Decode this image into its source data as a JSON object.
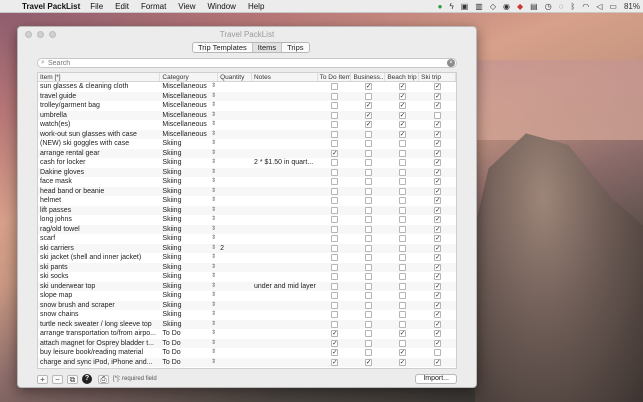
{
  "menubar": {
    "app": "Travel PackList",
    "menus": [
      "File",
      "Edit",
      "Format",
      "View",
      "Window",
      "Help"
    ],
    "battery": "81%"
  },
  "window": {
    "title": "Travel PackList",
    "tabs": [
      "Trip Templates",
      "Items",
      "Trips"
    ],
    "active_tab": "Items"
  },
  "search": {
    "placeholder": "Search"
  },
  "table": {
    "headers": [
      "Item [*]",
      "Category",
      "Quantity",
      "Notes",
      "To Do Item",
      "Business...",
      "Beach trip",
      "Ski trip"
    ],
    "rows": [
      {
        "item": "sun glasses & cleaning cloth",
        "category": "Miscellaneous",
        "qty": "",
        "notes": "",
        "todo": false,
        "business": true,
        "beach": true,
        "ski": true
      },
      {
        "item": "travel guide",
        "category": "Miscellaneous",
        "qty": "",
        "notes": "",
        "todo": false,
        "business": false,
        "beach": true,
        "ski": true
      },
      {
        "item": "trolley/garment bag",
        "category": "Miscellaneous",
        "qty": "",
        "notes": "",
        "todo": false,
        "business": true,
        "beach": true,
        "ski": true
      },
      {
        "item": "umbrella",
        "category": "Miscellaneous",
        "qty": "",
        "notes": "",
        "todo": false,
        "business": true,
        "beach": true,
        "ski": false
      },
      {
        "item": "watch(es)",
        "category": "Miscellaneous",
        "qty": "",
        "notes": "",
        "todo": false,
        "business": true,
        "beach": true,
        "ski": true
      },
      {
        "item": "work-out sun glasses with case",
        "category": "Miscellaneous",
        "qty": "",
        "notes": "",
        "todo": false,
        "business": false,
        "beach": true,
        "ski": true
      },
      {
        "item": "(NEW) ski goggles with case",
        "category": "Skiing",
        "qty": "",
        "notes": "",
        "todo": false,
        "business": false,
        "beach": false,
        "ski": true
      },
      {
        "item": "arrange rental gear",
        "category": "Skiing",
        "qty": "",
        "notes": "",
        "todo": true,
        "business": false,
        "beach": false,
        "ski": true
      },
      {
        "item": "cash for locker",
        "category": "Skiing",
        "qty": "",
        "notes": "2 * $1.50 in quart...",
        "todo": false,
        "business": false,
        "beach": false,
        "ski": true
      },
      {
        "item": "Dakine gloves",
        "category": "Skiing",
        "qty": "",
        "notes": "",
        "todo": false,
        "business": false,
        "beach": false,
        "ski": true
      },
      {
        "item": "face mask",
        "category": "Skiing",
        "qty": "",
        "notes": "",
        "todo": false,
        "business": false,
        "beach": false,
        "ski": true
      },
      {
        "item": "head band or beanie",
        "category": "Skiing",
        "qty": "",
        "notes": "",
        "todo": false,
        "business": false,
        "beach": false,
        "ski": true
      },
      {
        "item": "helmet",
        "category": "Skiing",
        "qty": "",
        "notes": "",
        "todo": false,
        "business": false,
        "beach": false,
        "ski": true
      },
      {
        "item": "lift passes",
        "category": "Skiing",
        "qty": "",
        "notes": "",
        "todo": false,
        "business": false,
        "beach": false,
        "ski": true
      },
      {
        "item": "long johns",
        "category": "Skiing",
        "qty": "",
        "notes": "",
        "todo": false,
        "business": false,
        "beach": false,
        "ski": true
      },
      {
        "item": "rag/old towel",
        "category": "Skiing",
        "qty": "",
        "notes": "",
        "todo": false,
        "business": false,
        "beach": false,
        "ski": true
      },
      {
        "item": "scarf",
        "category": "Skiing",
        "qty": "",
        "notes": "",
        "todo": false,
        "business": false,
        "beach": false,
        "ski": true
      },
      {
        "item": "ski carriers",
        "category": "Skiing",
        "qty": "2",
        "notes": "",
        "todo": false,
        "business": false,
        "beach": false,
        "ski": true
      },
      {
        "item": "ski jacket (shell and inner jacket)",
        "category": "Skiing",
        "qty": "",
        "notes": "",
        "todo": false,
        "business": false,
        "beach": false,
        "ski": true
      },
      {
        "item": "ski pants",
        "category": "Skiing",
        "qty": "",
        "notes": "",
        "todo": false,
        "business": false,
        "beach": false,
        "ski": true
      },
      {
        "item": "ski socks",
        "category": "Skiing",
        "qty": "",
        "notes": "",
        "todo": false,
        "business": false,
        "beach": false,
        "ski": true
      },
      {
        "item": "ski underwear top",
        "category": "Skiing",
        "qty": "",
        "notes": "under and mid layer",
        "todo": false,
        "business": false,
        "beach": false,
        "ski": true
      },
      {
        "item": "slope map",
        "category": "Skiing",
        "qty": "",
        "notes": "",
        "todo": false,
        "business": false,
        "beach": false,
        "ski": true
      },
      {
        "item": "snow brush and scraper",
        "category": "Skiing",
        "qty": "",
        "notes": "",
        "todo": false,
        "business": false,
        "beach": false,
        "ski": true
      },
      {
        "item": "snow chains",
        "category": "Skiing",
        "qty": "",
        "notes": "",
        "todo": false,
        "business": false,
        "beach": false,
        "ski": true
      },
      {
        "item": "turtle neck sweater / long sleeve top",
        "category": "Skiing",
        "qty": "",
        "notes": "",
        "todo": false,
        "business": false,
        "beach": false,
        "ski": true
      },
      {
        "item": "arrange transportation to/from airpo...",
        "category": "To Do",
        "qty": "",
        "notes": "",
        "todo": true,
        "business": false,
        "beach": true,
        "ski": true
      },
      {
        "item": "attach magnet for Osprey bladder t...",
        "category": "To Do",
        "qty": "",
        "notes": "",
        "todo": true,
        "business": false,
        "beach": false,
        "ski": true
      },
      {
        "item": "buy leisure book/reading material",
        "category": "To Do",
        "qty": "",
        "notes": "",
        "todo": true,
        "business": false,
        "beach": true,
        "ski": false
      },
      {
        "item": "charge and sync iPod, iPhone and...",
        "category": "To Do",
        "qty": "",
        "notes": "",
        "todo": true,
        "business": true,
        "beach": true,
        "ski": true
      }
    ]
  },
  "bottombar": {
    "add": "+",
    "remove": "−",
    "help": "?",
    "required_note": "[*]: required field",
    "import": "Import..."
  }
}
